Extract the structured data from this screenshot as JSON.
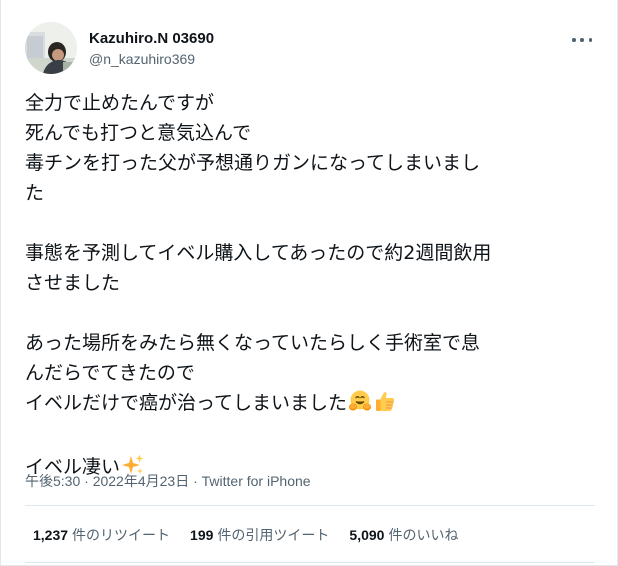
{
  "author": {
    "display_name": "Kazuhiro.N 03690",
    "handle": "@n_kazuhiro369"
  },
  "icons": {
    "more": "more-horizontal-icon",
    "hugging_face": "hugging-face-emoji",
    "thumbs_up": "thumbs-up-emoji",
    "sparkles": "sparkles-emoji"
  },
  "tweet": {
    "paragraphs": [
      [
        "全力で止めたんですが",
        "死んでも打つと意気込んで",
        "毒チンを打った父が予想通りガンになってしまいまし",
        "た"
      ],
      [
        "事態を予測してイベル購入してあったので約2週間飲用",
        "させました"
      ],
      [
        "あった場所をみたら無くなっていたらしく手術室で息",
        "んだらでてきたので",
        "イベルだけで癌が治ってしまいました"
      ],
      [
        "イベル凄い"
      ]
    ]
  },
  "meta": {
    "timestamp": "午後5:30 · 2022年4月23日 · Twitter for iPhone"
  },
  "stats": {
    "retweets_count": "1,237",
    "retweets_label": "件のリツイート",
    "quotes_count": "199",
    "quotes_label": "件の引用ツイート",
    "likes_count": "5,090",
    "likes_label": "件のいいね"
  },
  "colors": {
    "text": "#0f1419",
    "secondary": "#536471",
    "divider": "#e1e8ed"
  }
}
